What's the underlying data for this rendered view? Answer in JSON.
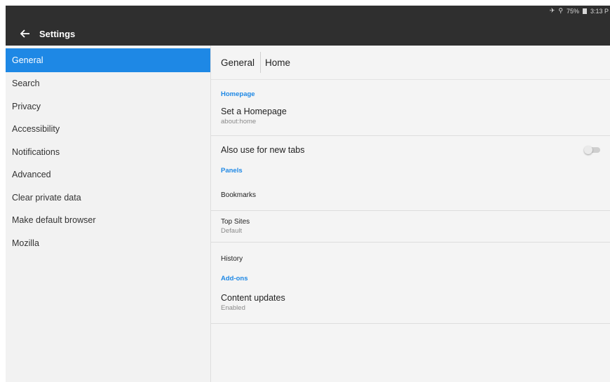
{
  "status_bar": {
    "signal": "✈",
    "wifi": "⚲",
    "battery": "75%",
    "time": "3:13 P"
  },
  "toolbar": {
    "back_icon": "arrow-left-icon",
    "title": "Settings"
  },
  "sidebar": {
    "items": [
      {
        "label": "General",
        "active": true
      },
      {
        "label": "Search"
      },
      {
        "label": "Privacy"
      },
      {
        "label": "Accessibility"
      },
      {
        "label": "Notifications"
      },
      {
        "label": "Advanced"
      },
      {
        "label": "Clear private data"
      },
      {
        "label": "Make default browser"
      },
      {
        "label": "Mozilla"
      }
    ]
  },
  "breadcrumb": {
    "first": "General",
    "second": "Home"
  },
  "sections": {
    "homepage": {
      "title": "Homepage",
      "set_homepage": {
        "title": "Set a Homepage",
        "summary": "about:home"
      },
      "new_tabs": {
        "title": "Also use for new tabs",
        "checked": false
      }
    },
    "panels": {
      "title": "Panels",
      "bookmarks": {
        "title": "Bookmarks"
      },
      "top_sites": {
        "title": "Top Sites",
        "summary": "Default"
      },
      "history": {
        "title": "History"
      }
    },
    "addons": {
      "title": "Add-ons",
      "content_updates": {
        "title": "Content updates",
        "summary": "Enabled"
      }
    }
  },
  "colors": {
    "accent": "#1e88e5",
    "toolbar": "#2f2f2f",
    "sidebar_bg": "#f2f2f2",
    "content_bg": "#f4f4f4"
  }
}
